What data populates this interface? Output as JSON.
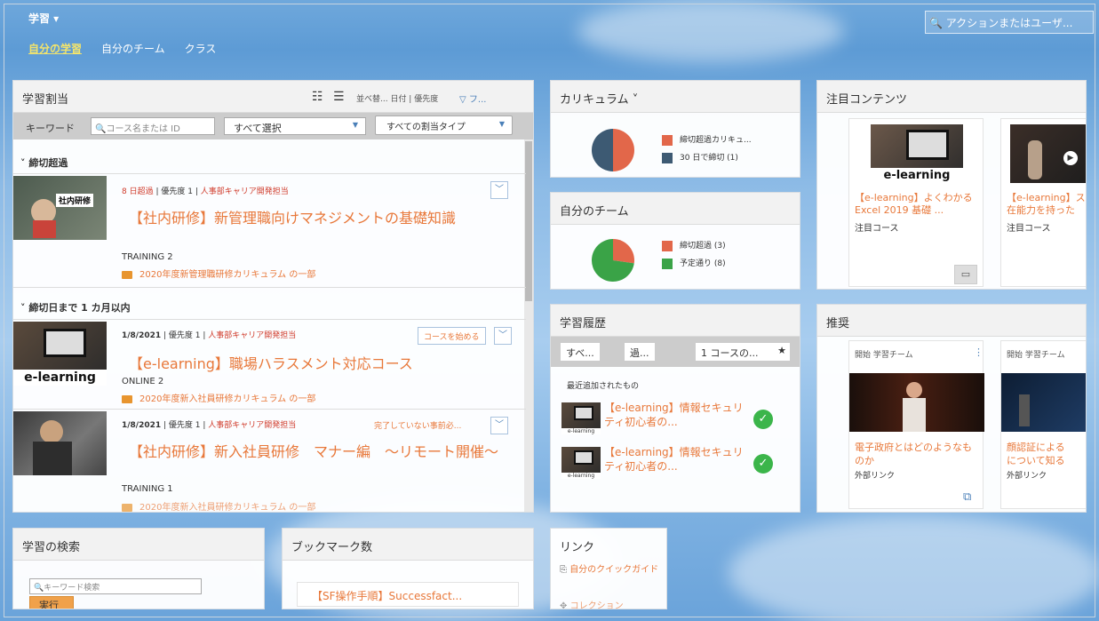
{
  "topbar": {
    "app_title": "学習 ▾",
    "search_placeholder": "アクションまたはユーザ...",
    "tabs": [
      "自分の学習",
      "自分のチーム",
      "クラス"
    ]
  },
  "assign": {
    "title": "学習割当",
    "sort_label": "並べ替... 日付 | 優先度",
    "filter_label": "フ...",
    "keyword_label": "キーワード",
    "keyword_placeholder": "コース名または ID",
    "select_all": "すべて選択",
    "assign_type": "すべての割当タイプ",
    "section1": "締切超過",
    "section2": "締切日まで 1 カ月以内",
    "items": [
      {
        "meta_date": "8 日超過",
        "priority": "優先度 1",
        "owner": "人事部キャリア開発担当",
        "title": "【社内研修】新管理職向けマネジメントの基礎知識",
        "code": "TRAINING 2",
        "curriculum": "2020年度新管理職研修カリキュラム の一部",
        "thumb_text": "社内研修"
      },
      {
        "meta_date": "1/8/2021",
        "priority": "優先度 1",
        "owner": "人事部キャリア開発担当",
        "action": "コースを始める",
        "title": "【e-learning】職場ハラスメント対応コース",
        "code": "ONLINE 2",
        "curriculum": "2020年度新入社員研修カリキュラム の一部",
        "thumb_text": "e-learning"
      },
      {
        "meta_date": "1/8/2021",
        "priority": "優先度 1",
        "owner": "人事部キャリア開発担当",
        "action": "完了していない事前必...",
        "title": "【社内研修】新入社員研修　マナー編　～リモート開催～",
        "code": "TRAINING 1",
        "curriculum": "2020年度新入社員研修カリキュラム の一部"
      }
    ]
  },
  "curriculum": {
    "title": "カリキュラム ˅",
    "legend": [
      "締切超過カリキュ...",
      "30 日で締切 (1)"
    ]
  },
  "team": {
    "title": "自分のチーム",
    "legend": [
      "締切超過 (3)",
      "予定通り (8)"
    ]
  },
  "history": {
    "title": "学習履歴",
    "pills": [
      "すべ...",
      "過...",
      "1 コースの..."
    ],
    "recent_label": "最近追加されたもの",
    "items": [
      "【e-learning】情報セキュリティ初心者の...",
      "【e-learning】情報セキュリティ初心者の..."
    ]
  },
  "featured": {
    "title": "注目コンテンツ",
    "cards": [
      {
        "title": "【e-learning】よくわかる Excel 2019 基礎 ...",
        "type": "注目コース",
        "thumb_text": "e-learning"
      },
      {
        "title": "【e-learning】ス\n在能力を持った",
        "type": "注目コース"
      }
    ]
  },
  "recommend": {
    "title": "推奨",
    "cards": [
      {
        "header": "開始 学習チーム",
        "title": "電子政府とはどのようなものか",
        "type": "外部リンク"
      },
      {
        "header": "開始 学習チーム",
        "title": "顔認証による\nについて知る",
        "type": "外部リンク"
      }
    ]
  },
  "search": {
    "title": "学習の検索",
    "placeholder": "キーワード検索",
    "button": "実行"
  },
  "bookmark": {
    "title": "ブックマーク数",
    "item": "【SF操作手順】Successfact..."
  },
  "links": {
    "title": "リンク",
    "item1": "自分のクイックガイド",
    "item2": "コレクション"
  },
  "colors": {
    "orange": "#e8783a",
    "slate": "#3d5a73",
    "green": "#3aa347",
    "accent": "#d03b2b"
  },
  "chart_curriculum": {
    "type": "pie",
    "values": [
      50,
      50
    ]
  },
  "chart_team": {
    "type": "pie",
    "values": [
      3,
      8
    ]
  }
}
